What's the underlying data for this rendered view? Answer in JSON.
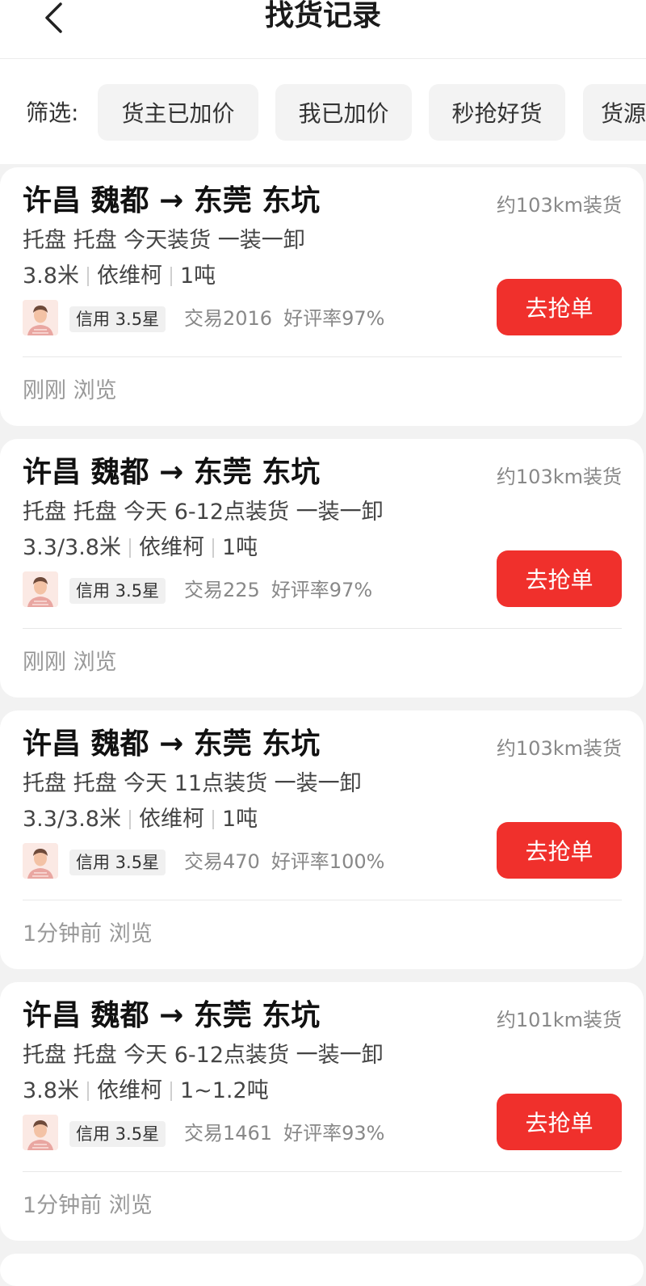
{
  "header": {
    "title": "找货记录",
    "back_icon": "chevron-left-icon"
  },
  "filter": {
    "label": "筛选:",
    "chips": [
      "货主已加价",
      "我已加价",
      "秒抢好货",
      "货源"
    ]
  },
  "colors": {
    "accent": "#f0302c",
    "background": "#f2f2f2"
  },
  "cards": [
    {
      "route": "许昌 魏都 → 东莞 东坑",
      "distance": "约103km装货",
      "desc": "托盘 托盘 今天装货 一装一卸",
      "specs": [
        "3.8米",
        "依维柯",
        "1吨"
      ],
      "credit": "信用 3.5星",
      "trades": "交易2016",
      "rating": "好评率97%",
      "button": "去抢单",
      "viewed": "刚刚 浏览"
    },
    {
      "route": "许昌 魏都 → 东莞 东坑",
      "distance": "约103km装货",
      "desc": "托盘 托盘 今天 6-12点装货 一装一卸",
      "specs": [
        "3.3/3.8米",
        "依维柯",
        "1吨"
      ],
      "credit": "信用 3.5星",
      "trades": "交易225",
      "rating": "好评率97%",
      "button": "去抢单",
      "viewed": "刚刚 浏览"
    },
    {
      "route": "许昌 魏都 → 东莞 东坑",
      "distance": "约103km装货",
      "desc": "托盘 托盘 今天 11点装货 一装一卸",
      "specs": [
        "3.3/3.8米",
        "依维柯",
        "1吨"
      ],
      "credit": "信用 3.5星",
      "trades": "交易470",
      "rating": "好评率100%",
      "button": "去抢单",
      "viewed": "1分钟前 浏览"
    },
    {
      "route": "许昌 魏都 → 东莞 东坑",
      "distance": "约101km装货",
      "desc": "托盘 托盘 今天 6-12点装货 一装一卸",
      "specs": [
        "3.8米",
        "依维柯",
        "1~1.2吨"
      ],
      "credit": "信用 3.5星",
      "trades": "交易1461",
      "rating": "好评率93%",
      "button": "去抢单",
      "viewed": "1分钟前 浏览"
    }
  ]
}
